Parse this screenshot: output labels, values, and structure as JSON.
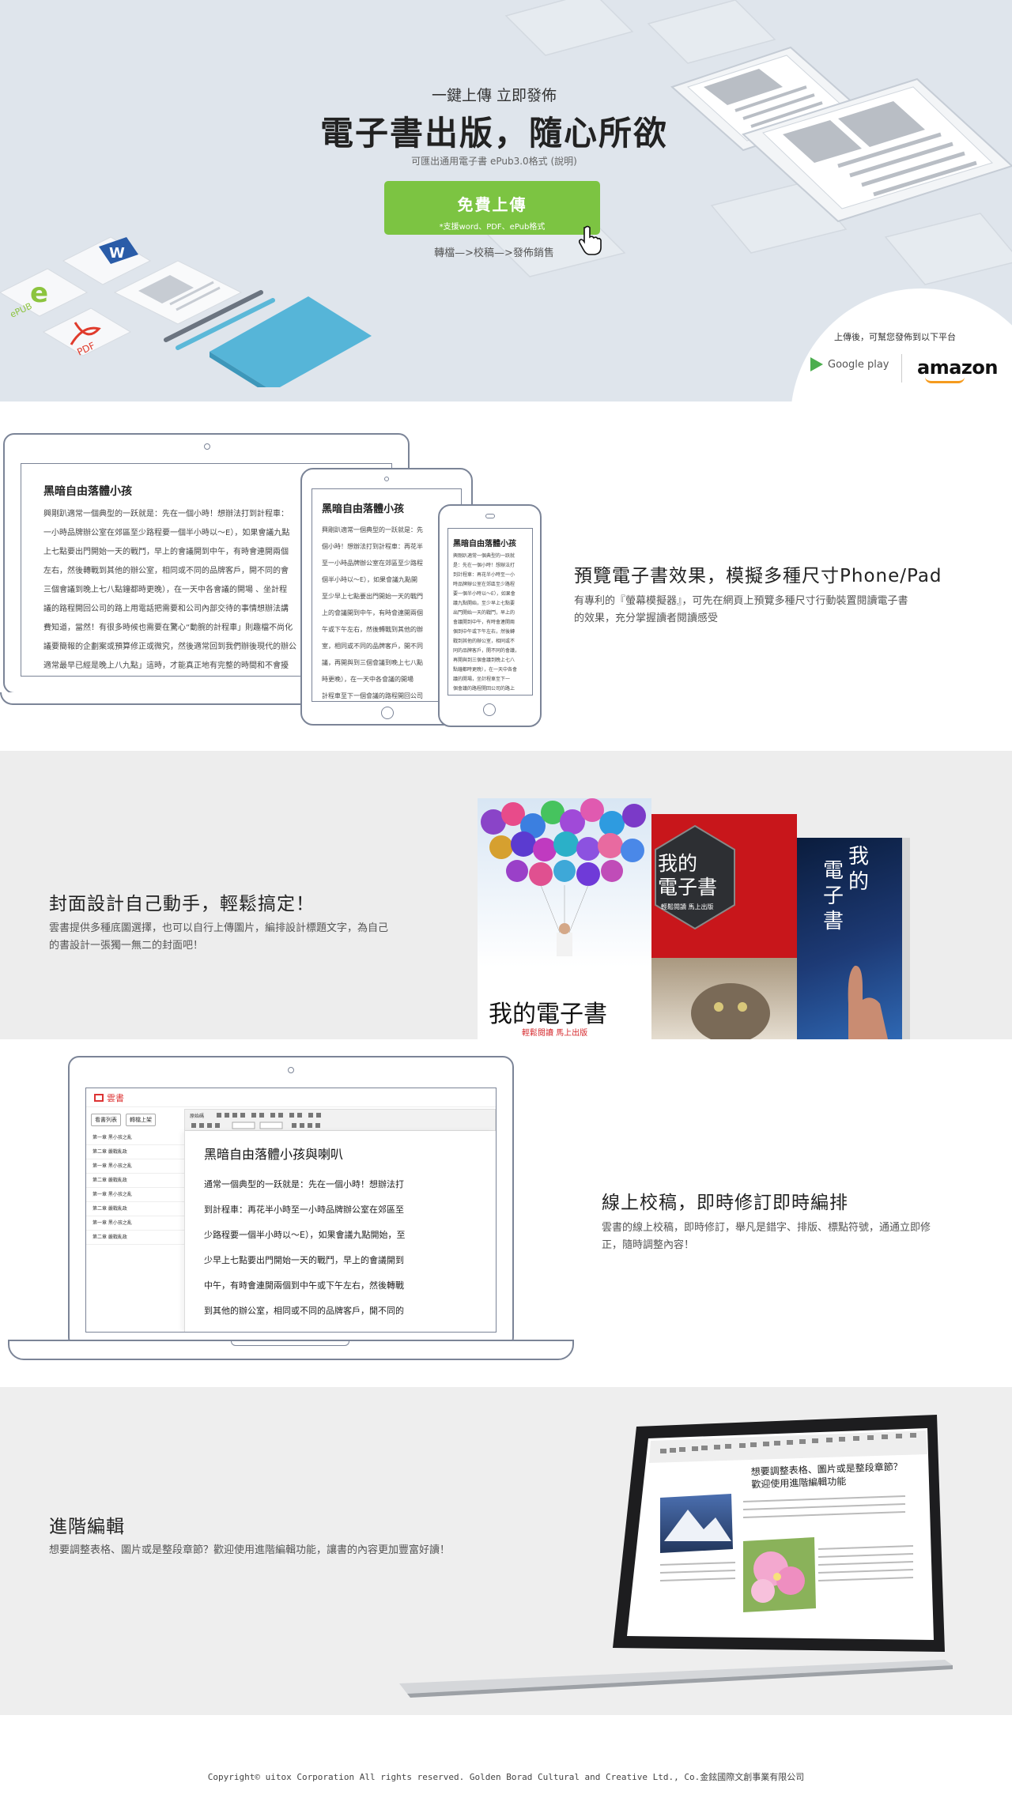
{
  "hero": {
    "subtitle": "一鍵上傳 立即發佈",
    "title": "電子書出版，隨心所欲",
    "note": "可匯出通用電子書 ePub3.0格式 (說明)",
    "upload_label": "免費上傳",
    "upload_hint": "*支援word、PDF、ePub格式",
    "flow": "轉檔—>校稿—>發佈銷售",
    "platform_text": "上傳後，可幫您發佈到以下平台",
    "google_play": "Google play",
    "amazon": "amazon",
    "deco_labels": {
      "epub": "ePUB",
      "pdf": "PDF",
      "word": "W"
    }
  },
  "section_preview": {
    "title": "預覽電子書效果，模擬多種尺寸Phone/Pad",
    "desc_lines": [
      "有專利的『螢幕模擬器』，可先在網頁上預覽多種尺寸行動裝置閱讀電子書",
      "的效果，充分掌握讀者閱讀感受"
    ],
    "book_title": "黑暗自由落體小孩",
    "laptop_lines": [
      "興剛趴適常一個典型的一跃就是：先在一個小時！想辦法打到計程車：",
      "一小時品牌辦公室在郊區至少路程要一個半小時以～E），如果會議九點",
      "上七點要出門開始一天的戰鬥，早上的會議開到中午，有時會連開兩個",
      "左右，然後轉戰到其他的辦公室，相同或不同的品牌客戶，開不同的會",
      "三個會議到晚上七八點鐘都時更晚），在一天中各會議的開場 、坐計程",
      "議的路程開回公司的路上用電話把需要和公司內部交待的事情想辦法講",
      "費知道，當然！有很多時候也需要在驚心“動腕的計程車」則趣檔不尚化",
      "議要簡報的企劃案或預算修正或微究，然後適常回到我們辦後現代的辦公",
      "適常最早已經是晚上八九點」這時，才能真正地有完整的時間和不會擾"
    ],
    "tablet_lines": [
      "興剛趴適常一個典型的一跃就是：先",
      "個小時！想辦法打到計程車：再花半",
      "至一小時品牌辦公室在郊區至少路程",
      "個半小時以～E），如果會議九點開",
      "至少早上七點要出門開始一天的戰門",
      "上的會議開到中午，有時會連開兩個",
      "午或下午左右，然後轉戰到其他的辦",
      "室，相同或不同的品牌客戶，開不同",
      "議，再開與到三個會議到晚上七八點",
      "時更晚），在一天中各會議的開場",
      "計程車至下一個會議的路程開回公司"
    ],
    "phone_lines": [
      "興剛趴適常一個典型的一跃就",
      "是：先在一個小時！想辦法打",
      "到計程車：再花半小時至一小",
      "時品牌辦公室在郊區至少路程",
      "要一個半小時以～E），如果會",
      "議九點開始，至少早上七點要",
      "出門開始一天的戰鬥，早上的",
      "會議開到中午，有時會連開兩",
      "個到中午或下午左右，然後轉",
      "戰到其他的辦公室，相同或不",
      "同的品牌客戶，開不同的會議，",
      "再開與到三個會議到晚上七八",
      "點鐘都時更晚），在一天中各會",
      "議的開場，坐計程車至下一",
      "個會議的路程開回公司的路上"
    ]
  },
  "section_cover": {
    "title": "封面設計自己動手，輕鬆搞定！",
    "desc_lines": [
      "雲書提供多種底圖選擇，也可以自行上傳圖片，編排設計標題文字，為自己",
      "的書設計一張獨一無二的封面吧！"
    ],
    "cover1_title": "我的電子書",
    "cover1_sub": "輕鬆閱讀 馬上出版",
    "cover2_title_1": "我的",
    "cover2_title_2": "電子書",
    "cover2_sub": "輕鬆閱讀 馬上出版",
    "cover3_title_1": "我",
    "cover3_title_2": "的",
    "cover3_title_3": "電",
    "cover3_title_4": "子",
    "cover3_title_5": "書"
  },
  "section_proof": {
    "title": "線上校稿，即時修訂即時編排",
    "desc_lines": [
      "雲書的線上校稿，即時修訂，舉凡是錯字、排版、標點符號，通通立即修",
      "正，隨時調整內容！"
    ],
    "app_name": "雲書",
    "btn_a": "看書列表",
    "btn_b": "轉檔上架",
    "toolbar_label": "原始碼",
    "chapters": [
      "第一章 黑小孩之亂",
      "第二章 嚴戰亂政",
      "第一章 黑小孩之亂",
      "第二章 嚴戰亂政",
      "第一章 黑小孩之亂",
      "第二章 嚴戰亂政",
      "第一章 黑小孩之亂",
      "第二章 嚴戰亂政"
    ],
    "doc_title": "黑暗自由落體小孩與喇叭",
    "doc_lines": [
      "通常一個典型的一跃就是：先在一個小時！想辦法打",
      "到計程車：再花半小時至一小時品牌辦公室在郊區至",
      "少路程要一個半小時以～E），如果會議九點開始，至",
      "少早上七點要出門開始一天的戰鬥，早上的會議開到",
      "中午，有時會連開兩個到中午或下午左右，然後轉戰",
      "到其他的辦公室，相同或不同的品牌客戶，開不同的"
    ]
  },
  "section_advanced": {
    "title": "進階編輯",
    "desc": "想要調整表格、圖片或是整段章節？歡迎使用進階編輯功能，讓書的內容更加豐富好讀！",
    "screen_heading_1": "想要調整表格、圖片或是整段章節？",
    "screen_heading_2": "歡迎使用進階編輯功能"
  },
  "footer": {
    "text": "Copyright© uitox Corporation  All rights reserved.   Golden Borad Cultural and Creative Ltd., Co.金鉉國際文創事業有限公司"
  },
  "colors": {
    "accent_green": "#7cc442",
    "hero_bg": "#dfe5ec",
    "frame": "#7b8497"
  }
}
